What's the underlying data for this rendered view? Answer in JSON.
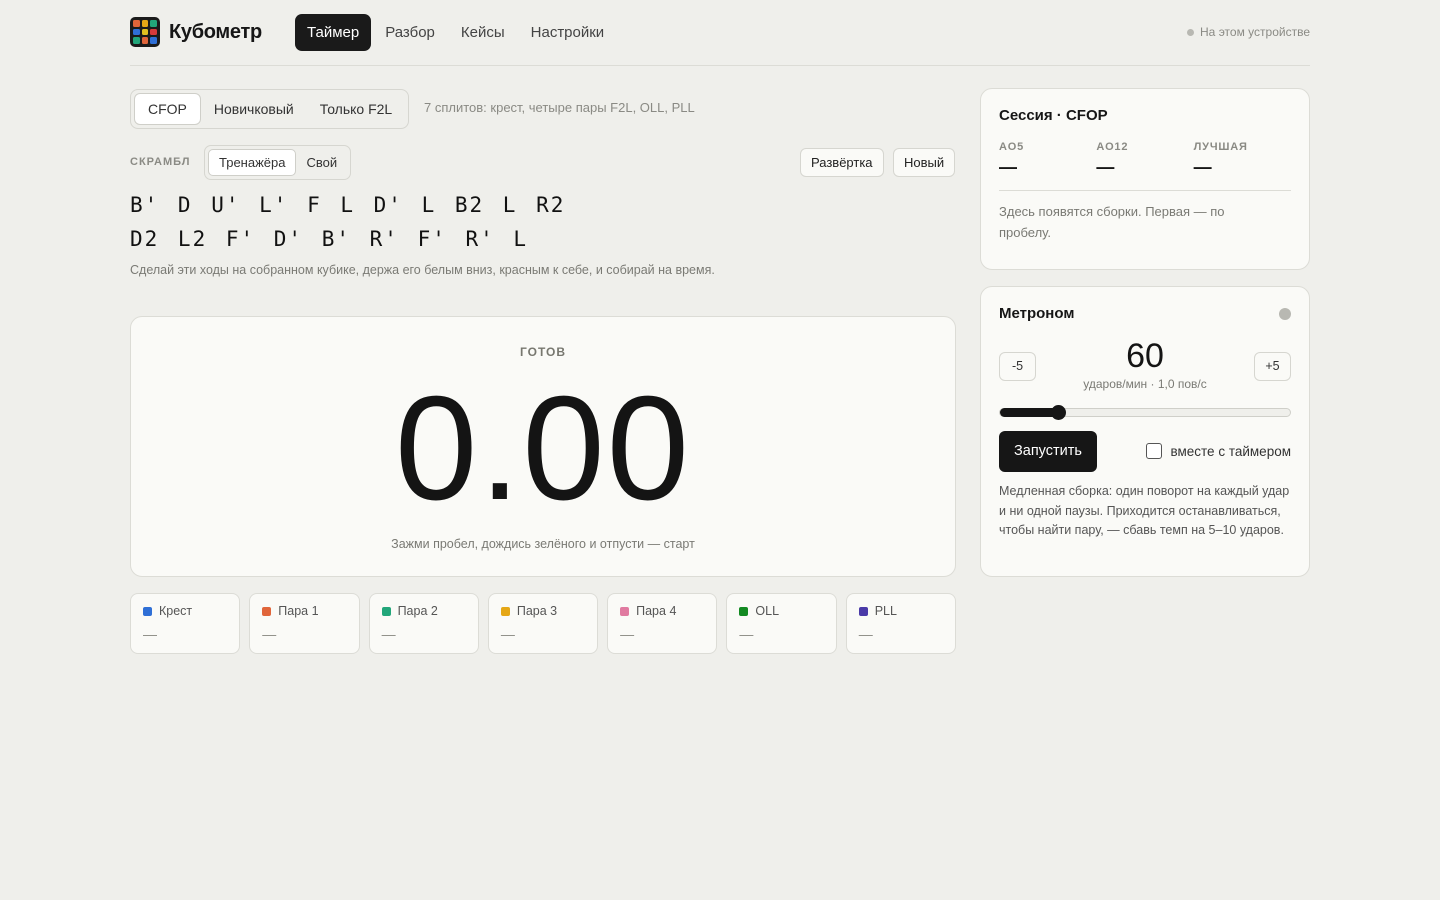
{
  "app": {
    "name": "Кубометр",
    "device_label": "На этом устройстве"
  },
  "nav": [
    {
      "label": "Таймер",
      "active": true
    },
    {
      "label": "Разбор",
      "active": false
    },
    {
      "label": "Кейсы",
      "active": false
    },
    {
      "label": "Настройки",
      "active": false
    }
  ],
  "methods": {
    "items": [
      "CFOP",
      "Новичковый",
      "Только F2L"
    ],
    "selected": "CFOP",
    "description": "7 сплитов: крест, четыре пары F2L, OLL, PLL"
  },
  "scramble": {
    "label": "СКРАМБЛ",
    "sources": [
      "Тренажёра",
      "Свой"
    ],
    "selected_source": "Тренажёра",
    "net_button": "Развёртка",
    "new_button": "Новый",
    "line1": "B' D U' L' F L D' L B2 L R2",
    "line2": "D2 L2 F' D' B' R' F' R' L",
    "hint": "Сделай эти ходы на собранном кубике, держа его белым вниз, красным к себе, и собирай на время."
  },
  "timer": {
    "status": "ГОТОВ",
    "value": "0.00",
    "hint": "Зажми пробел, дождись зелёного и отпусти — старт"
  },
  "splits": [
    {
      "name": "Крест",
      "value": "—",
      "color": "#2f6fd6"
    },
    {
      "name": "Пара 1",
      "value": "—",
      "color": "#e0653a"
    },
    {
      "name": "Пара 2",
      "value": "—",
      "color": "#22a67a"
    },
    {
      "name": "Пара 3",
      "value": "—",
      "color": "#e5a716"
    },
    {
      "name": "Пара 4",
      "value": "—",
      "color": "#e07aa0"
    },
    {
      "name": "OLL",
      "value": "—",
      "color": "#138a22"
    },
    {
      "name": "PLL",
      "value": "—",
      "color": "#4a3aa8"
    }
  ],
  "session": {
    "title": "Сессия · CFOP",
    "stats": [
      {
        "label": "AO5",
        "value": "—"
      },
      {
        "label": "AO12",
        "value": "—"
      },
      {
        "label": "ЛУЧШАЯ",
        "value": "—"
      }
    ],
    "empty_text": "Здесь появятся сборки. Первая — по пробелу."
  },
  "metronome": {
    "title": "Метроном",
    "minus_label": "-5",
    "plus_label": "+5",
    "bpm": "60",
    "bpm_sub": "ударов/мин · 1,0 пов/с",
    "slider_fraction": 0.2,
    "start_label": "Запустить",
    "with_timer_label": "вместе с таймером",
    "with_timer_checked": false,
    "note": "Медленная сборка: один поворот на каждый удар и ни одной паузы. Приходится останавливаться, чтобы найти пару, — сбавь темп на 5–10 ударов."
  },
  "colors": {
    "background": "#efefeb",
    "accent": "#161616",
    "logo_cube": [
      "#e0653a",
      "#e5a716",
      "#22a67a",
      "#2f6fd6",
      "#e0c020",
      "#d63a3a",
      "#22a67a",
      "#e0653a",
      "#2f6fd6"
    ]
  }
}
